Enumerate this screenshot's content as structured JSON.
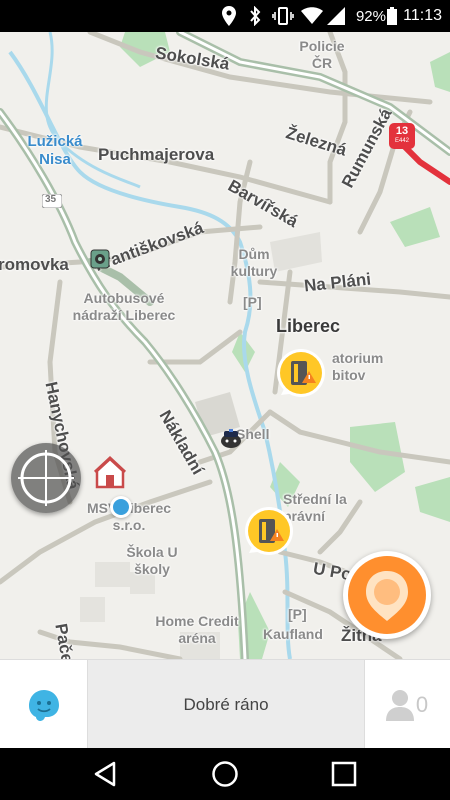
{
  "status_bar": {
    "icons": [
      "location-icon",
      "bluetooth-icon",
      "vibrate-icon",
      "wifi-icon",
      "signal-icon",
      "battery-icon"
    ],
    "battery": "92%",
    "time": "11:13"
  },
  "map": {
    "streets": [
      "Sokolská",
      "Železná",
      "Puchmajerova",
      "Barvířská",
      "Rumunská",
      "Františkovská",
      "Na Pláni",
      "romovka",
      "Hanychovská",
      "Nákladní",
      "U Po",
      "Žitná",
      "Pačeo"
    ],
    "places": [
      "Policie ČR",
      "Dům kultury",
      "Autobusové nádraží Liberec",
      "atorium bitov",
      "Shell",
      "MSV Liberec s.r.o.",
      "Škola U školy",
      "Střední la právní",
      "Home Credit aréna",
      "Kaufland"
    ],
    "parking_label": "[P]",
    "river": "Lužická Nisa",
    "city": "Liberec",
    "route_shield": "35",
    "highway_shield": "13",
    "highway_shield_sub": "E442",
    "colors": {
      "background": "#f1f0ec",
      "road": "#c9c7bd",
      "major_road": "#a7c0a8",
      "green": "#b9e0b9",
      "river": "#a9d9ec",
      "traffic_red": "#e3323c",
      "waze_orange": "#ff8f2e",
      "hazard_yellow": "#ffc726",
      "position_dot": "#3aa0dd",
      "waze_blue": "#3fb4e4"
    }
  },
  "bottom_bar": {
    "greeting": "Dobré ráno",
    "friends_count": "0"
  },
  "nav_bar": {
    "buttons": [
      "back-icon",
      "home-icon",
      "recents-icon"
    ]
  }
}
